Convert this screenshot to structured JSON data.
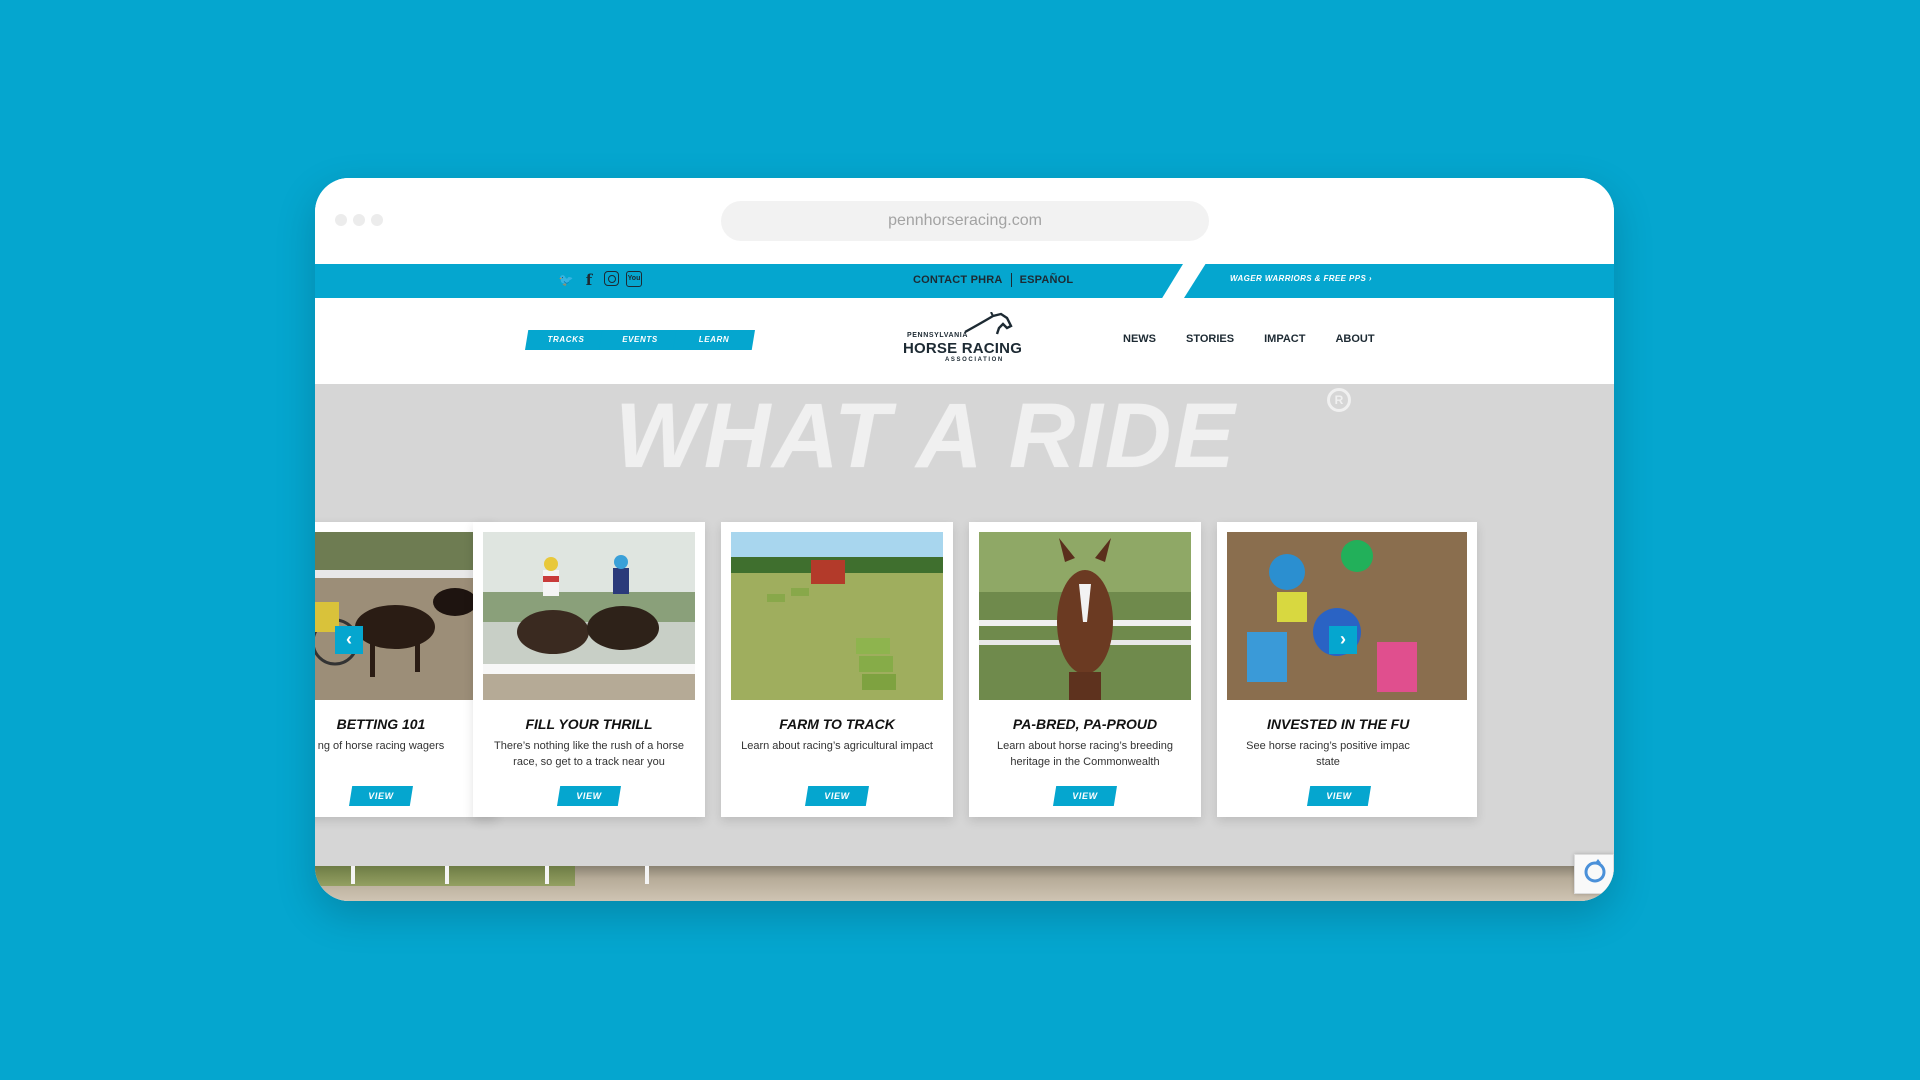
{
  "browser": {
    "url": "pennhorseracing.com"
  },
  "topbar": {
    "social_icons": [
      "twitter-icon",
      "facebook-icon",
      "instagram-icon",
      "youtube-icon"
    ],
    "twitter_glyph": "🐦",
    "facebook_glyph": "f",
    "youtube_glyph": "You",
    "contact": "CONTACT PHRA",
    "espanol": "ESPAÑOL",
    "wager": "WAGER WARRIORS & FREE PPS  ›"
  },
  "nav": {
    "pills": [
      "TRACKS",
      "EVENTS",
      "LEARN"
    ],
    "logo": {
      "small": "PENNSYLVANIA",
      "big": "HORSE RACING",
      "assoc": "ASSOCIATION"
    },
    "menu": [
      "NEWS",
      "STORIES",
      "IMPACT",
      "ABOUT"
    ]
  },
  "hero": {
    "title": "WHAT A RIDE",
    "registered": "R"
  },
  "cards": [
    {
      "title": "BETTING 101",
      "desc": "ng of horse racing wagers",
      "view": "VIEW"
    },
    {
      "title": "FILL YOUR THRILL",
      "desc": "There’s nothing like the rush of a horse race, so get to a track near you",
      "view": "VIEW"
    },
    {
      "title": "FARM TO TRACK",
      "desc": "Learn about racing’s agricultural impact",
      "view": "VIEW"
    },
    {
      "title": "PA-BRED, PA-PROUD",
      "desc": "Learn about horse racing’s breeding heritage in the Commonwealth",
      "view": "VIEW"
    },
    {
      "title": "INVESTED IN THE FU",
      "desc": "See horse racing’s positive impac state",
      "view": "VIEW"
    }
  ],
  "carousel": {
    "prev": "‹",
    "next": "›"
  },
  "colors": {
    "brand_blue": "#05a6cf",
    "hero_gray": "#d6d6d6"
  }
}
